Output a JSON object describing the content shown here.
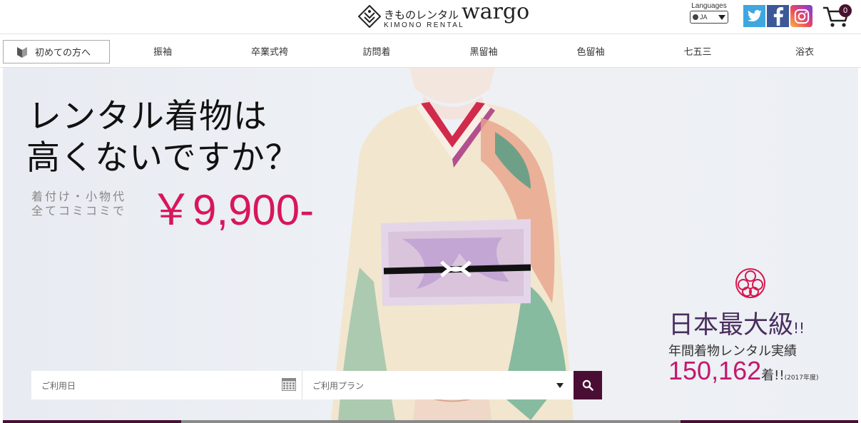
{
  "header": {
    "logo_jp": "きものレンタル",
    "logo_en": "wargo",
    "logo_sub": "KIMONO RENTAL",
    "languages_label": "Languages",
    "language_value": "JA",
    "cart_count": "0"
  },
  "nav": {
    "beginner_label": "初めての方へ",
    "items": [
      "振袖",
      "卒業式袴",
      "訪問着",
      "黒留袖",
      "色留袖",
      "七五三",
      "浴衣"
    ]
  },
  "hero": {
    "headline_line1": "レンタル着物は",
    "headline_line2": "高くないですか？",
    "sub_line1": "着付け・小物代",
    "sub_line2": "全てコミコミで",
    "price": "￥9,900-",
    "badge_title": "日本最大級",
    "badge_exclaim": "!!",
    "badge_sub": "年間着物レンタル実績",
    "badge_count": "150,162",
    "badge_unit": "着!!",
    "badge_year": "(2017年度)"
  },
  "search": {
    "date_placeholder": "ご利用日",
    "plan_placeholder": "ご利用プラン"
  },
  "colors": {
    "accent": "#d8165b",
    "brand_dark": "#4a0e34",
    "twitter": "#3ea7e0",
    "facebook": "#3b5998"
  }
}
